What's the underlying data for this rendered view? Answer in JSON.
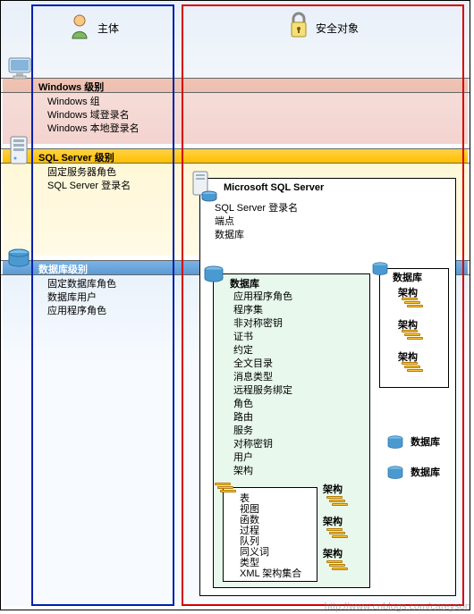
{
  "header": {
    "principals_title": "主体",
    "securables_title": "安全对象"
  },
  "windows_level": {
    "title": "Windows 级别",
    "items": [
      "Windows 组",
      "Windows 域登录名",
      "Windows 本地登录名"
    ]
  },
  "sqlserver_level": {
    "title": "SQL Server 级别",
    "items": [
      "固定服务器角色",
      "SQL Server 登录名"
    ]
  },
  "database_level": {
    "title": "数据库级别",
    "items": [
      "固定数据库角色",
      "数据库用户",
      "应用程序角色"
    ]
  },
  "sqlserver_box": {
    "title": "Microsoft SQL Server",
    "items": [
      "SQL Server 登录名",
      "端点",
      "数据库"
    ]
  },
  "database_box": {
    "title": "数据库",
    "items": [
      "应用程序角色",
      "程序集",
      "非对称密钥",
      "证书",
      "约定",
      "全文目录",
      "消息类型",
      "远程服务绑定",
      "角色",
      "路由",
      "服务",
      "对称密钥",
      "用户",
      "架构"
    ]
  },
  "database_side": {
    "title": "数据库",
    "schema_label": "架构",
    "extra_db_labels": [
      "数据库",
      "数据库"
    ]
  },
  "schema_box": {
    "items": [
      "表",
      "视图",
      "函数",
      "过程",
      "队列",
      "同义词",
      "类型",
      "XML 架构集合"
    ],
    "side_label": "架构"
  },
  "watermark": "http://www.cnblogs.com/careyson",
  "icons": {
    "user": "user-icon",
    "lock": "lock-icon",
    "monitor": "monitor-icon",
    "server": "server-icon",
    "server_small": "server-small-icon",
    "disk": "database-disk-icon",
    "tables": "schema-tables-icon"
  }
}
